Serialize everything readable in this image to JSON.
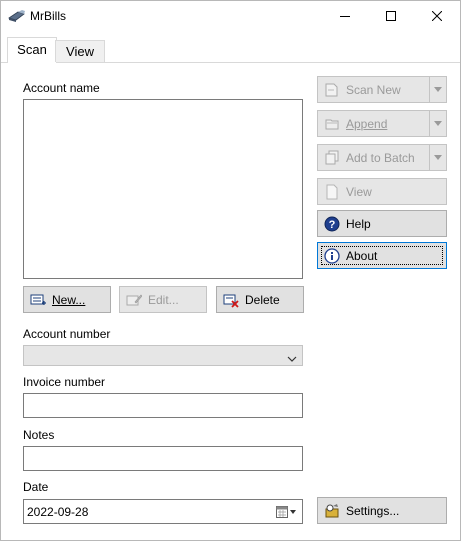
{
  "window": {
    "title": "MrBills"
  },
  "tabs": [
    {
      "label": "Scan"
    },
    {
      "label": "View"
    }
  ],
  "form": {
    "account_name_label": "Account name",
    "new_label": "New...",
    "edit_label": "Edit...",
    "delete_label": "Delete",
    "account_number_label": "Account number",
    "account_number_value": "",
    "invoice_number_label": "Invoice number",
    "invoice_number_value": "",
    "notes_label": "Notes",
    "notes_value": "",
    "date_label": "Date",
    "date_value": "2022-09-28"
  },
  "actions": {
    "scan_new": "Scan New",
    "append": "Append",
    "add_to_batch": "Add to Batch",
    "view": "View",
    "help": "Help",
    "about": "About",
    "settings": "Settings..."
  }
}
